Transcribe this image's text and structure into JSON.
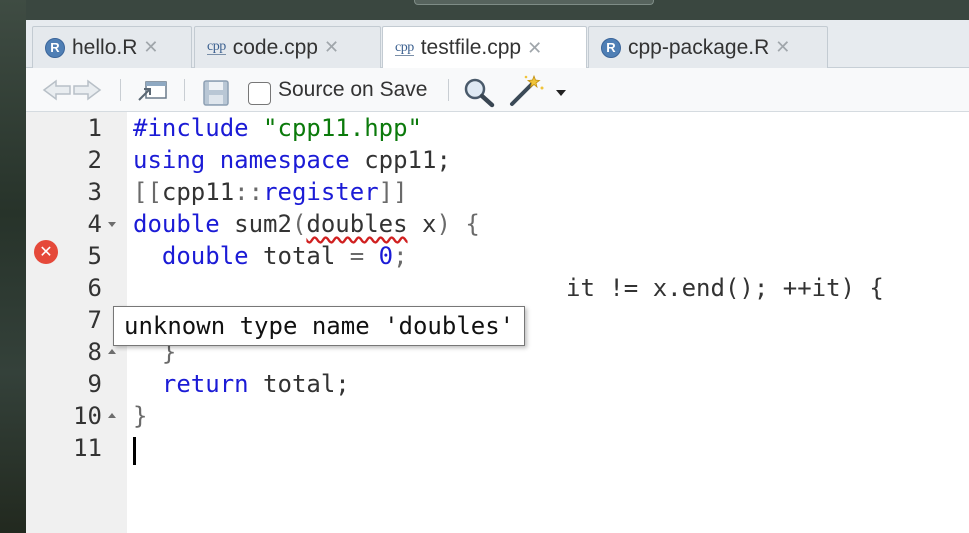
{
  "tabs": [
    {
      "label": "hello.R",
      "icon": "r-file-icon",
      "active": false
    },
    {
      "label": "code.cpp",
      "icon": "cpp-file-icon",
      "active": false
    },
    {
      "label": "testfile.cpp",
      "icon": "cpp-file-icon",
      "active": true
    },
    {
      "label": "cpp-package.R",
      "icon": "r-file-icon",
      "active": false
    }
  ],
  "icons": {
    "r_letter": "R",
    "cpp_text": "cpp",
    "close": "✕",
    "error": "✕"
  },
  "toolbar": {
    "source_on_save_label": "Source on Save",
    "source_on_save_checked": false
  },
  "gutter": {
    "line_numbers": [
      "1",
      "2",
      "3",
      "4",
      "5",
      "6",
      "7",
      "8",
      "9",
      "10",
      "11"
    ],
    "error_line": 4,
    "fold_down_lines": [
      4
    ],
    "fold_up_lines": [
      8,
      10
    ]
  },
  "code": {
    "l1_kw": "#include ",
    "l1_str": "\"cpp11.hpp\"",
    "l2_kw": "using namespace",
    "l2_rest": " cpp11;",
    "l3_open": "[[",
    "l3_ns": "cpp11",
    "l3_sep": "::",
    "l3_kw": "register",
    "l3_close": "]]",
    "l4_kw": "double",
    "l4_name": " sum2",
    "l4_paren": "(",
    "l4_err": "doubles",
    "l4_rest": " x",
    "l4_close": ") {",
    "l5_indent": "  ",
    "l5_kw": "double",
    "l5_var": " total ",
    "l5_op": "=",
    "l5_sp": " ",
    "l5_num": "0",
    "l5_semi": ";",
    "l6_visible": "it != x.end(); ++it) {",
    "l8_brace": "  }",
    "l9_indent": "  ",
    "l9_kw": "return",
    "l9_rest": " total;",
    "l10_brace": "}"
  },
  "tooltip": {
    "text": "unknown type name 'doubles'"
  },
  "colors": {
    "keyword": "#1b1bd6",
    "string": "#0b7a0b",
    "error": "#e5493a"
  }
}
